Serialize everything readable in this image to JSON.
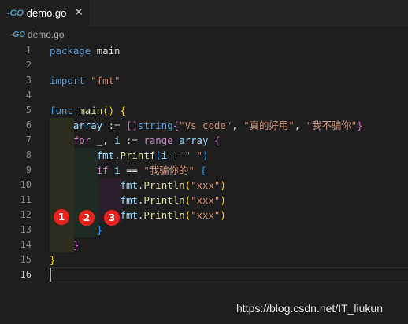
{
  "tab": {
    "icon": "go-file-icon",
    "icon_text": "-GO",
    "filename": "demo.go",
    "close_glyph": "✕"
  },
  "breadcrumb": {
    "icon": "go-file-icon",
    "icon_text": "-GO",
    "filename": "demo.go"
  },
  "line_numbers": [
    "1",
    "2",
    "3",
    "4",
    "5",
    "6",
    "7",
    "8",
    "9",
    "10",
    "11",
    "12",
    "13",
    "14",
    "15",
    "16"
  ],
  "active_line": "16",
  "code_lines": [
    [
      {
        "t": "package",
        "c": "kw"
      },
      {
        "t": " main"
      }
    ],
    [],
    [
      {
        "t": "import",
        "c": "kw"
      },
      {
        "t": " "
      },
      {
        "t": "\"fmt\"",
        "c": "str"
      }
    ],
    [],
    [
      {
        "t": "func",
        "c": "kw"
      },
      {
        "t": " "
      },
      {
        "t": "main",
        "c": "fn"
      },
      {
        "t": "()",
        "c": "b1"
      },
      {
        "t": " "
      },
      {
        "t": "{",
        "c": "b1"
      }
    ],
    [
      {
        "t": "    "
      },
      {
        "t": "array",
        "c": "var"
      },
      {
        "t": " := "
      },
      {
        "t": "[]",
        "c": "b2"
      },
      {
        "t": "string",
        "c": "kw"
      },
      {
        "t": "{",
        "c": "b2"
      },
      {
        "t": "\"Vs code\"",
        "c": "str"
      },
      {
        "t": ", "
      },
      {
        "t": "\"真的好用\"",
        "c": "str"
      },
      {
        "t": ", "
      },
      {
        "t": "\"我不骗你\"",
        "c": "str"
      },
      {
        "t": "}",
        "c": "b2"
      }
    ],
    [
      {
        "t": "    "
      },
      {
        "t": "for",
        "c": "ctl"
      },
      {
        "t": " _, "
      },
      {
        "t": "i",
        "c": "var"
      },
      {
        "t": " := "
      },
      {
        "t": "range",
        "c": "ctl"
      },
      {
        "t": " "
      },
      {
        "t": "array",
        "c": "var"
      },
      {
        "t": " "
      },
      {
        "t": "{",
        "c": "b2"
      }
    ],
    [
      {
        "t": "        "
      },
      {
        "t": "fmt",
        "c": "var"
      },
      {
        "t": "."
      },
      {
        "t": "Printf",
        "c": "fn"
      },
      {
        "t": "(",
        "c": "b3"
      },
      {
        "t": "i",
        "c": "var"
      },
      {
        "t": " + "
      },
      {
        "t": "\" \"",
        "c": "str"
      },
      {
        "t": ")",
        "c": "b3"
      }
    ],
    [
      {
        "t": "        "
      },
      {
        "t": "if",
        "c": "ctl"
      },
      {
        "t": " "
      },
      {
        "t": "i",
        "c": "var"
      },
      {
        "t": " == "
      },
      {
        "t": "\"我骗你的\"",
        "c": "str"
      },
      {
        "t": " "
      },
      {
        "t": "{",
        "c": "b3"
      }
    ],
    [
      {
        "t": "            "
      },
      {
        "t": "fmt",
        "c": "var"
      },
      {
        "t": "."
      },
      {
        "t": "Println",
        "c": "fn"
      },
      {
        "t": "(",
        "c": "b1"
      },
      {
        "t": "\"xxx\"",
        "c": "str"
      },
      {
        "t": ")",
        "c": "b1"
      }
    ],
    [
      {
        "t": "            "
      },
      {
        "t": "fmt",
        "c": "var"
      },
      {
        "t": "."
      },
      {
        "t": "Println",
        "c": "fn"
      },
      {
        "t": "(",
        "c": "b1"
      },
      {
        "t": "\"xxx\"",
        "c": "str"
      },
      {
        "t": ")",
        "c": "b1"
      }
    ],
    [
      {
        "t": "            "
      },
      {
        "t": "fmt",
        "c": "var"
      },
      {
        "t": "."
      },
      {
        "t": "Println",
        "c": "fn"
      },
      {
        "t": "(",
        "c": "b1"
      },
      {
        "t": "\"xxx\"",
        "c": "str"
      },
      {
        "t": ")",
        "c": "b1"
      }
    ],
    [
      {
        "t": "        "
      },
      {
        "t": "}",
        "c": "b3"
      }
    ],
    [
      {
        "t": "    "
      },
      {
        "t": "}",
        "c": "b2"
      }
    ],
    [
      {
        "t": "}",
        "c": "b1"
      }
    ],
    []
  ],
  "annotations": [
    "1",
    "2",
    "3"
  ],
  "watermark": "https://blog.csdn.net/IT_liukun",
  "colors": {
    "editor_bg": "#1e1e1e",
    "indent_level_1": "#2c2c1f",
    "indent_level_2": "#1f2b22",
    "indent_level_3": "#2b1f2b",
    "badge": "#e8231d",
    "go_icon": "#519aba"
  }
}
